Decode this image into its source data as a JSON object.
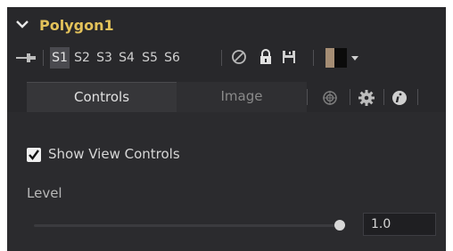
{
  "header": {
    "title": "Polygon1"
  },
  "toolbar": {
    "shapes": [
      "S1",
      "S2",
      "S3",
      "S4",
      "S5",
      "S6"
    ],
    "active_shape": "S1",
    "color_swatch": {
      "primary": "#a58d74",
      "secondary": "#0b0b0b"
    }
  },
  "tabs": [
    {
      "label": "Controls",
      "active": true
    },
    {
      "label": "Image",
      "active": false
    }
  ],
  "controls": {
    "show_view_controls": {
      "label": "Show View Controls",
      "checked": true
    },
    "level": {
      "label": "Level",
      "value": "1.0",
      "fraction": 1.0
    }
  },
  "colors": {
    "title": "#e3c25a",
    "panel": "#28282b",
    "content": "#2b2b2e"
  }
}
